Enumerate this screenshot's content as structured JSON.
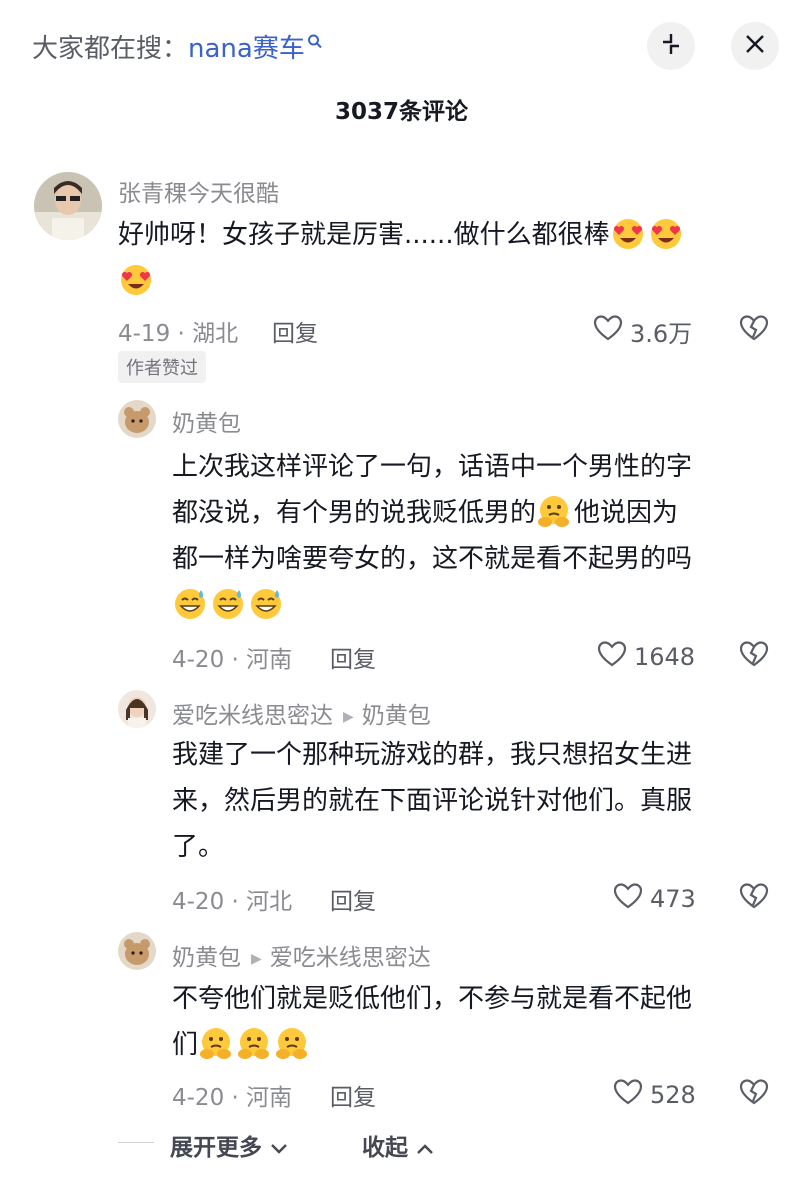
{
  "header": {
    "search_prefix": "大家都在搜：",
    "search_keyword": "nana赛车",
    "comment_count_title": "3037条评论"
  },
  "comments": [
    {
      "user": "张青稞今天很酷",
      "text_line1": "好帅呀！女孩子就是厉害......做什么都很棒",
      "date_loc": "4-19 · 湖北",
      "reply_label": "回复",
      "likes": "3.6万",
      "author_tag": "作者赞过"
    },
    {
      "user": "奶黄包",
      "text_line1": "上次我这样评论了一句，话语中一个男性的字",
      "text_line2": "都没说，有个男的说我贬低男的",
      "text_line2b": "他说因为",
      "text_line3": "都一样为啥要夸女的，这不就是看不起男的吗",
      "date_loc": "4-20 · 河南",
      "reply_label": "回复",
      "likes": "1648"
    },
    {
      "user": "爱吃米线思密达",
      "reply_to": "奶黄包",
      "text_line1": "我建了一个那种玩游戏的群，我只想招女生进",
      "text_line2": "来，然后男的就在下面评论说针对他们。真服",
      "text_line3": "了。",
      "date_loc": "4-20 · 河北",
      "reply_label": "回复",
      "likes": "473"
    },
    {
      "user": "奶黄包",
      "reply_to": "爱吃米线思密达",
      "text_line1": "不夸他们就是贬低他们，不参与就是看不起他",
      "text_line2": "们",
      "date_loc": "4-20 · 河南",
      "reply_label": "回复",
      "likes": "528"
    }
  ],
  "footer": {
    "expand_more": "展开更多",
    "collapse": "收起"
  },
  "colors": {
    "keyword_blue": "#3b62c9",
    "muted_text": "#8a8b91",
    "emoji_yellow": "#ffc93c",
    "heart_eyes_red": "#f2364a"
  },
  "icons": [
    "search-icon",
    "expand-icon",
    "close-icon",
    "heart-icon",
    "broken-heart-icon",
    "chevron-down-icon",
    "chevron-up-icon",
    "heart-eyes-emoji",
    "thinking-emoji",
    "sweat-smile-emoji"
  ]
}
